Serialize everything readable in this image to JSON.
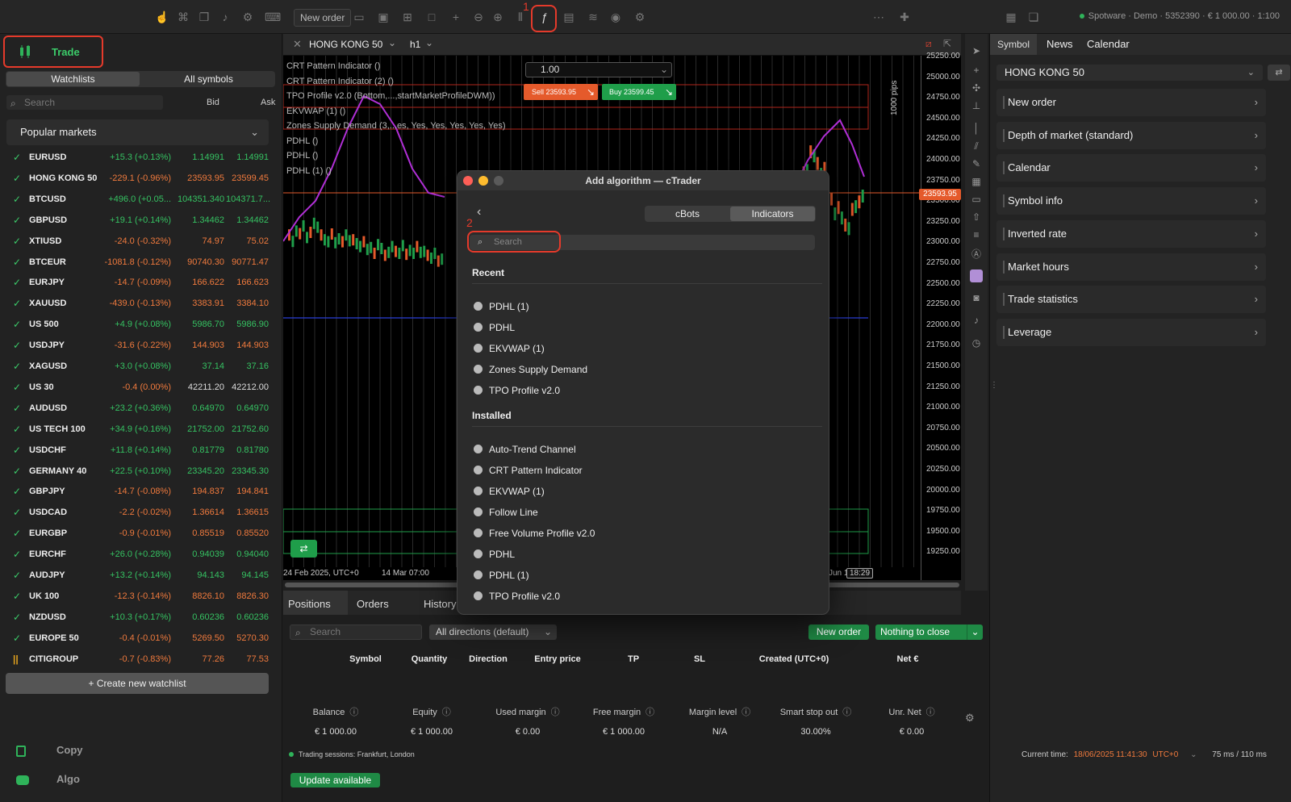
{
  "toolbar": {
    "new_order": "New order",
    "account": "Spotware · Demo · 5352390 · € 1 000.00 · 1:100"
  },
  "left": {
    "logo_label": "Trade",
    "tab_watchlists": "Watchlists",
    "tab_all_symbols": "All symbols",
    "search_placeholder": "Search",
    "bid_header": "Bid",
    "ask_header": "Ask",
    "list_name": "Popular markets",
    "rows": [
      {
        "sym": "EURUSD",
        "chg": "+15.3 (+0.13%)",
        "bid": "1.14991",
        "ask": "1.14991",
        "dir": "pos"
      },
      {
        "sym": "HONG KONG 50",
        "chg": "-229.1 (-0.96%)",
        "bid": "23593.95",
        "ask": "23599.45",
        "dir": "neg"
      },
      {
        "sym": "BTCUSD",
        "chg": "+496.0 (+0.05...",
        "bid": "104351.340",
        "ask": "104371.7...",
        "dir": "pos"
      },
      {
        "sym": "GBPUSD",
        "chg": "+19.1 (+0.14%)",
        "bid": "1.34462",
        "ask": "1.34462",
        "dir": "pos"
      },
      {
        "sym": "XTIUSD",
        "chg": "-24.0 (-0.32%)",
        "bid": "74.97",
        "ask": "75.02",
        "dir": "neg"
      },
      {
        "sym": "BTCEUR",
        "chg": "-1081.8 (-0.12%)",
        "bid": "90740.30",
        "ask": "90771.47",
        "dir": "neg"
      },
      {
        "sym": "EURJPY",
        "chg": "-14.7 (-0.09%)",
        "bid": "166.622",
        "ask": "166.623",
        "dir": "neg"
      },
      {
        "sym": "XAUUSD",
        "chg": "-439.0 (-0.13%)",
        "bid": "3383.91",
        "ask": "3384.10",
        "dir": "neg"
      },
      {
        "sym": "US 500",
        "chg": "+4.9 (+0.08%)",
        "bid": "5986.70",
        "ask": "5986.90",
        "dir": "pos"
      },
      {
        "sym": "USDJPY",
        "chg": "-31.6 (-0.22%)",
        "bid": "144.903",
        "ask": "144.903",
        "dir": "neg"
      },
      {
        "sym": "XAGUSD",
        "chg": "+3.0 (+0.08%)",
        "bid": "37.14",
        "ask": "37.16",
        "dir": "pos"
      },
      {
        "sym": "US 30",
        "chg": "-0.4 (0.00%)",
        "bid": "42211.20",
        "ask": "42212.00",
        "dir": "neg"
      },
      {
        "sym": "AUDUSD",
        "chg": "+23.2 (+0.36%)",
        "bid": "0.64970",
        "ask": "0.64970",
        "dir": "pos"
      },
      {
        "sym": "US TECH 100",
        "chg": "+34.9 (+0.16%)",
        "bid": "21752.00",
        "ask": "21752.60",
        "dir": "pos"
      },
      {
        "sym": "USDCHF",
        "chg": "+11.8 (+0.14%)",
        "bid": "0.81779",
        "ask": "0.81780",
        "dir": "pos"
      },
      {
        "sym": "GERMANY 40",
        "chg": "+22.5 (+0.10%)",
        "bid": "23345.20",
        "ask": "23345.30",
        "dir": "pos"
      },
      {
        "sym": "GBPJPY",
        "chg": "-14.7 (-0.08%)",
        "bid": "194.837",
        "ask": "194.841",
        "dir": "neg"
      },
      {
        "sym": "USDCAD",
        "chg": "-2.2 (-0.02%)",
        "bid": "1.36614",
        "ask": "1.36615",
        "dir": "neg"
      },
      {
        "sym": "EURGBP",
        "chg": "-0.9 (-0.01%)",
        "bid": "0.85519",
        "ask": "0.85520",
        "dir": "neg"
      },
      {
        "sym": "EURCHF",
        "chg": "+26.0 (+0.28%)",
        "bid": "0.94039",
        "ask": "0.94040",
        "dir": "pos"
      },
      {
        "sym": "AUDJPY",
        "chg": "+13.2 (+0.14%)",
        "bid": "94.143",
        "ask": "94.145",
        "dir": "pos"
      },
      {
        "sym": "UK 100",
        "chg": "-12.3 (-0.14%)",
        "bid": "8826.10",
        "ask": "8826.30",
        "dir": "neg"
      },
      {
        "sym": "NZDUSD",
        "chg": "+10.3 (+0.17%)",
        "bid": "0.60236",
        "ask": "0.60236",
        "dir": "pos"
      },
      {
        "sym": "EUROPE 50",
        "chg": "-0.4 (-0.01%)",
        "bid": "5269.50",
        "ask": "5270.30",
        "dir": "neg"
      },
      {
        "sym": "CITIGROUP",
        "chg": "-0.7 (-0.83%)",
        "bid": "77.26",
        "ask": "77.53",
        "dir": "neg"
      }
    ],
    "create_watchlist": "Create new watchlist",
    "copy": "Copy",
    "algo": "Algo"
  },
  "chart": {
    "symbol": "HONG KONG 50",
    "timeframe": "h1",
    "indicators": [
      "CRT Pattern Indicator ()",
      "CRT Pattern Indicator (2) ()",
      "TPO Profile v2.0 (Bottom,...,startMarketProfileDWM))",
      "EKVWAP (1) ()",
      "Zones Supply Demand (3,...es, Yes, Yes, Yes, Yes, Yes)",
      "PDHL ()",
      "PDHL ()",
      "PDHL (1) ()"
    ],
    "qty": "1.00",
    "sell": "Sell 23593.95",
    "buy": "Buy 23599.45",
    "pips_label": "1000 pips",
    "price_ticks": [
      "25250.00",
      "25000.00",
      "24750.00",
      "24500.00",
      "24250.00",
      "24000.00",
      "23750.00",
      "23500.00",
      "23250.00",
      "23000.00",
      "22750.00",
      "22500.00",
      "22250.00",
      "22000.00",
      "21750.00",
      "21500.00",
      "21250.00",
      "21000.00",
      "20750.00",
      "20500.00",
      "20250.00",
      "20000.00",
      "19750.00",
      "19500.00",
      "19250.00"
    ],
    "current_price": "23593.95",
    "date_left": "24 Feb 2025, UTC+0",
    "date_mid": "14 Mar 07:00",
    "date_right": "Jun 10:00",
    "countdown": "18:29"
  },
  "dialog": {
    "title": "Add algorithm — cTrader",
    "tab_cbots": "cBots",
    "tab_indicators": "Indicators",
    "search_placeholder": "Search",
    "recent_title": "Recent",
    "recent": [
      "PDHL (1)",
      "PDHL",
      "EKVWAP (1)",
      "Zones Supply Demand",
      "TPO Profile v2.0"
    ],
    "installed_title": "Installed",
    "installed": [
      "Auto-Trend Channel",
      "CRT Pattern Indicator",
      "EKVWAP (1)",
      "Follow Line",
      "Free Volume Profile v2.0",
      "PDHL",
      "PDHL (1)",
      "TPO Profile v2.0"
    ]
  },
  "right": {
    "tab_symbol": "Symbol",
    "tab_news": "News",
    "tab_calendar": "Calendar",
    "symbol": "HONG KONG 50",
    "cards": [
      "New order",
      "Depth of market (standard)",
      "Calendar",
      "Symbol info",
      "Inverted rate",
      "Market hours",
      "Trade statistics",
      "Leverage"
    ]
  },
  "bottom": {
    "tab_positions": "Positions",
    "tab_orders": "Orders",
    "tab_history": "History",
    "search_placeholder": "Search",
    "direction": "All directions (default)",
    "new_order": "New order",
    "nothing_to_close": "Nothing to close",
    "columns": [
      "Symbol",
      "Quantity",
      "Direction",
      "Entry price",
      "TP",
      "SL",
      "Created (UTC+0)",
      "Net €"
    ],
    "summary": [
      {
        "label": "Balance",
        "value": "€ 1 000.00"
      },
      {
        "label": "Equity",
        "value": "€ 1 000.00"
      },
      {
        "label": "Used margin",
        "value": "€ 0.00"
      },
      {
        "label": "Free margin",
        "value": "€ 1 000.00"
      },
      {
        "label": "Margin level",
        "value": "N/A"
      },
      {
        "label": "Smart stop out",
        "value": "30.00%"
      },
      {
        "label": "Unr. Net",
        "value": "€ 0.00"
      }
    ],
    "sessions": "Trading sessions: Frankfurt, London",
    "current_time_label": "Current time:",
    "current_time": "18/06/2025 11:41:30",
    "tz": "UTC+0",
    "latency": "75 ms / 110 ms",
    "update": "Update available"
  },
  "annotations": {
    "one": "1",
    "two": "2"
  },
  "colors": {
    "green": "#2fb35a",
    "red": "#e55a2b",
    "annotation": "#e53a2b"
  }
}
